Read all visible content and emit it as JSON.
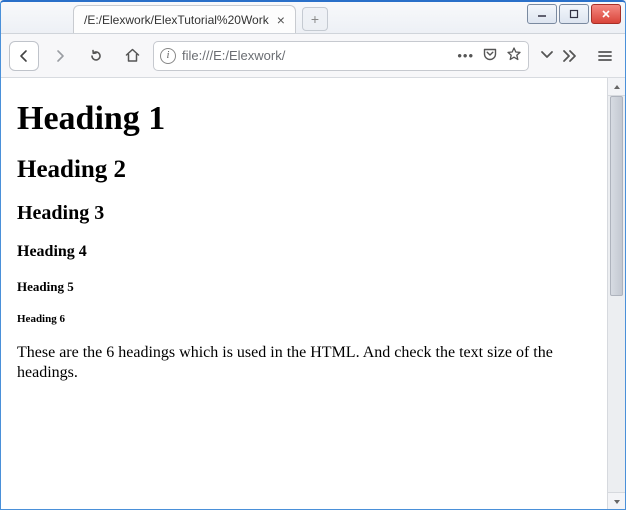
{
  "window": {
    "tab_title": "/E:/Elexwork/ElexTutorial%20Work",
    "urlbar_text": "file:///E:/Elexwork/"
  },
  "page": {
    "h1": "Heading 1",
    "h2": "Heading 2",
    "h3": "Heading 3",
    "h4": "Heading 4",
    "h5": "Heading 5",
    "h6": "Heading 6",
    "paragraph": "These are the 6 headings which is used in the HTML. And check the text size of the headings."
  }
}
